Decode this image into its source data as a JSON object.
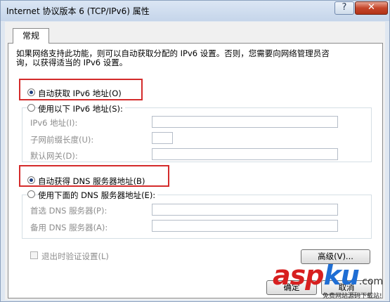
{
  "window": {
    "title": "Internet 协议版本 6 (TCP/IPv6) 属性",
    "help_label": "?",
    "close_label": "✕"
  },
  "tabs": [
    {
      "label": "常规"
    }
  ],
  "description": {
    "line1": "如果网络支持此功能，则可以自动获取分配的 IPv6 设置。否则，您需要向网络管理员咨",
    "line2": "询，以获得适当的 IPv6 设置。"
  },
  "ip": {
    "auto_label": "自动获取 IPv6 地址(O)",
    "manual_label": "使用以下 IPv6 地址(S):",
    "selected": "auto",
    "fields": {
      "address_label": "IPv6 地址(I):",
      "address_value": "",
      "prefix_label": "子网前缀长度(U):",
      "prefix_value": "",
      "gateway_label": "默认网关(D):",
      "gateway_value": ""
    }
  },
  "dns": {
    "auto_label": "自动获得 DNS 服务器地址(B)",
    "manual_label": "使用下面的 DNS 服务器地址(E):",
    "selected": "auto",
    "fields": {
      "preferred_label": "首选 DNS 服务器(P):",
      "preferred_value": "",
      "alternate_label": "备用 DNS 服务器(A):",
      "alternate_value": ""
    }
  },
  "validate_on_exit": {
    "label": "退出时验证设置(L)",
    "checked": false
  },
  "buttons": {
    "advanced": "高级(V)...",
    "ok": "确定",
    "cancel": "取消"
  },
  "watermark": {
    "brand_main": "asp",
    "brand_accent": "ku",
    "brand_suffix": ".com",
    "tagline": "免费网站源码下载站!"
  },
  "colors": {
    "highlight_box": "#d42b2b",
    "watermark_red": "#d71f1f",
    "watermark_blue": "#1f6ed4",
    "title_bar": "#c5d5ea"
  }
}
